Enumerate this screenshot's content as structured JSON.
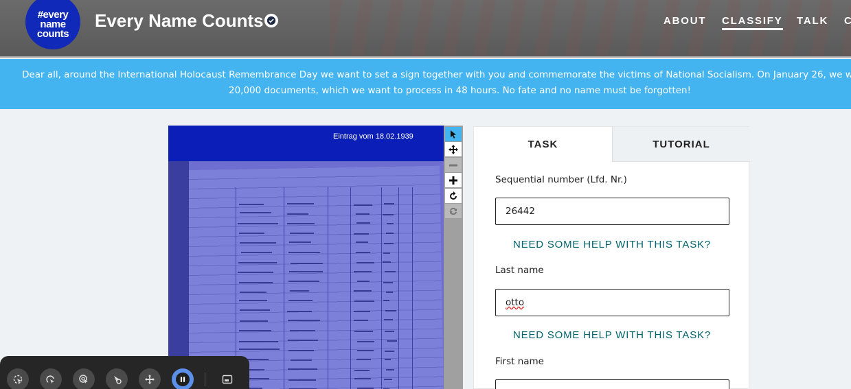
{
  "header": {
    "logo_lines": [
      "#every",
      "name",
      "counts"
    ],
    "title": "Every Name Counts",
    "verified_icon": "check-circle-icon",
    "nav": [
      {
        "label": "ABOUT",
        "active": false
      },
      {
        "label": "CLASSIFY",
        "active": true
      },
      {
        "label": "TALK",
        "active": false
      },
      {
        "label": "C",
        "active": false
      }
    ]
  },
  "banner": {
    "line1": "Dear all, around the International Holocaust Remembrance Day we want to set a sign together with you and commemorate the victims of National Socialism. On January 26, we w",
    "line2": "20,000 documents, which we want to process in 48 hours. No fate and no name must be forgotten!"
  },
  "viewer": {
    "entry_label": "Eintrag vom 18.02.1939",
    "tools": [
      {
        "name": "pointer-icon",
        "state": "selected"
      },
      {
        "name": "move-icon",
        "state": "enabled"
      },
      {
        "name": "zoom-out-icon",
        "state": "disabled"
      },
      {
        "name": "zoom-in-icon",
        "state": "enabled"
      },
      {
        "name": "rotate-icon",
        "state": "enabled"
      },
      {
        "name": "reset-icon",
        "state": "disabled"
      }
    ]
  },
  "panel": {
    "tabs": [
      "TASK",
      "TUTORIAL"
    ],
    "fields": [
      {
        "label": "Sequential number (Lfd. Nr.)",
        "value": "26442"
      },
      {
        "label": "Last name",
        "value": "otto"
      },
      {
        "label": "First name",
        "value": ""
      }
    ],
    "help_text": "NEED SOME HELP WITH THIS TASK?"
  },
  "floatbar": {
    "buttons": [
      "select-icon",
      "redo-icon",
      "cursor-icon",
      "target-icon",
      "drag-icon",
      "pause-icon",
      "window-icon"
    ]
  },
  "colors": {
    "banner": "#43b4f0",
    "logo": "#1029b8",
    "help_link": "#00626a",
    "tool_selected": "#43b4f0"
  }
}
